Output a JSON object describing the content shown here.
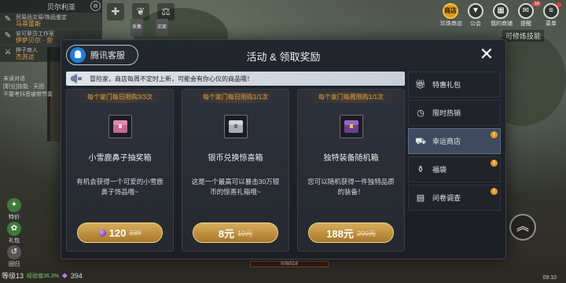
{
  "hud": {
    "region": "贝尔利亚",
    "quests": [
      {
        "line1": "贸易品交易/饰品鉴定",
        "line2": "马蒂蕾斯"
      },
      {
        "line1": "安可萝莎工作室",
        "line2": "伊萨贝尔 · 奈"
      },
      {
        "line1": "押子商人",
        "line2": "杰苏达"
      }
    ],
    "chat_lines": [
      "未读对话",
      "[职业]技能 · 天团",
      "不要考抖音被带节奏"
    ],
    "left_buttons": [
      "特价",
      "礼包",
      "回归"
    ],
    "top_icons": [
      {
        "icon": "gift-icon",
        "label": ""
      },
      {
        "icon": "leaf-icon",
        "label": "采集"
      },
      {
        "icon": "bag-icon",
        "label": "买家"
      }
    ],
    "menu": [
      {
        "label": "珍珠商店",
        "glyph": "商店"
      },
      {
        "label": "公会",
        "glyph": "▼"
      },
      {
        "label": "我的商铺",
        "glyph": "▦"
      },
      {
        "label": "提醒",
        "glyph": "✉",
        "bubble": "16"
      },
      {
        "label": "菜单",
        "glyph": "≡"
      }
    ],
    "skill_toggle": "可修炼技能",
    "level": "等级13",
    "exp": "经验值36.3%",
    "gems": "394",
    "hp": "508/518",
    "time": "09:10"
  },
  "modal": {
    "cs_label": "腾讯客服",
    "title": "活动 & 领取奖励",
    "banner": "冒险家，商店每周不定时上新，可能会有你心仪的商品哦！",
    "cards": [
      {
        "limit": "每个家门每日限购3/3次",
        "name": "小雪鹿鼻子抽奖箱",
        "desc": "有机会获得一个可爱的小雪鹿鼻子饰品哦~",
        "price": "120",
        "orig": "230",
        "pearl": true
      },
      {
        "limit": "每个家门每周限购1/1次",
        "name": "独特装备随机箱",
        "desc": "您可以随机获得一件独特品质的装备！",
        "price": "188元",
        "orig": "200元",
        "pearl": false
      }
    ],
    "card_middle": {
      "limit": "每个家门每日限购1/1次",
      "name": "银币兑换惊喜箱",
      "desc": "这是一个最高可以暴击30万银币的惊喜礼箱哦~",
      "price": "8元",
      "orig": "10元"
    },
    "tabs": [
      {
        "label": "特惠礼包",
        "icon": "gift-box-icon",
        "badge": ""
      },
      {
        "label": "限时热销",
        "icon": "clock-icon",
        "badge": ""
      },
      {
        "label": "幸运商店",
        "icon": "lucky-shop-icon",
        "badge": "!"
      },
      {
        "label": "福袋",
        "icon": "lucky-bag-icon",
        "badge": "!"
      },
      {
        "label": "问卷调查",
        "icon": "survey-icon",
        "badge": "!"
      }
    ]
  },
  "colors": {
    "accent_gold": "#d6ad5a",
    "limit_text": "#e3a24b",
    "tab_active": "#3e4a5e",
    "badge": "#e9961f"
  }
}
